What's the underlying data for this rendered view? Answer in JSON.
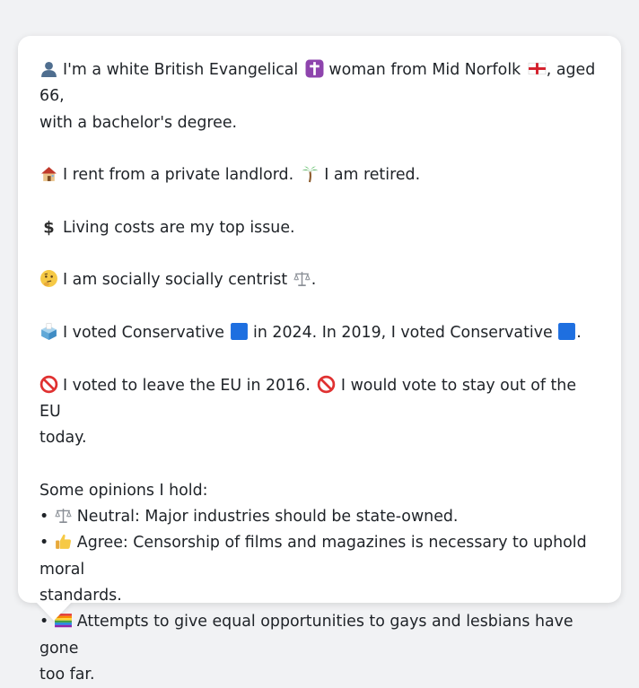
{
  "persona": {
    "identity": {
      "before_cross": "I'm a white British Evangelical",
      "middle": "woman from Mid Norfolk",
      "end": ", aged 66,",
      "line2": "with a bachelor's degree."
    },
    "housing": {
      "text": "I rent from a private landlord.",
      "work": "I am retired."
    },
    "issue": {
      "text": "Living costs are my top issue."
    },
    "social": {
      "text": "I am socially socially centrist",
      "end": "."
    },
    "votes": {
      "part1": "I voted Conservative",
      "part2": "in 2024. In 2019, I voted Conservative",
      "end": "."
    },
    "eu": {
      "part1": "I voted to leave the EU in 2016.",
      "part2": "I would vote to stay out of the EU",
      "line2": "today."
    },
    "opinions": {
      "heading": "Some opinions I hold:",
      "bullet": "•",
      "items": [
        {
          "line1": "Neutral: Major industries should be state-owned.",
          "line2": ""
        },
        {
          "line1": "Agree: Censorship of films and magazines is necessary to uphold moral",
          "line2": "standards."
        },
        {
          "line1": "Attempts to give equal opportunities to gays and lesbians have gone",
          "line2": "too far."
        }
      ]
    }
  },
  "icons": {
    "person": "bust-in-silhouette-icon",
    "cross": "latin-cross-icon",
    "flag": "england-flag-icon",
    "house": "house-icon",
    "palm": "palm-tree-icon",
    "dollar": "dollar-sign-icon",
    "thinking": "thinking-face-icon",
    "scales": "balance-scale-icon",
    "ballot": "ballot-box-icon",
    "party": "blue-square-icon",
    "no": "prohibited-icon",
    "thumb": "thumbs-up-icon",
    "rainbow": "rainbow-flag-icon"
  },
  "colors": {
    "background": "#f1f2f4",
    "bubble": "#ffffff",
    "text": "#1f2328",
    "conservative": "#1e6fe0"
  }
}
